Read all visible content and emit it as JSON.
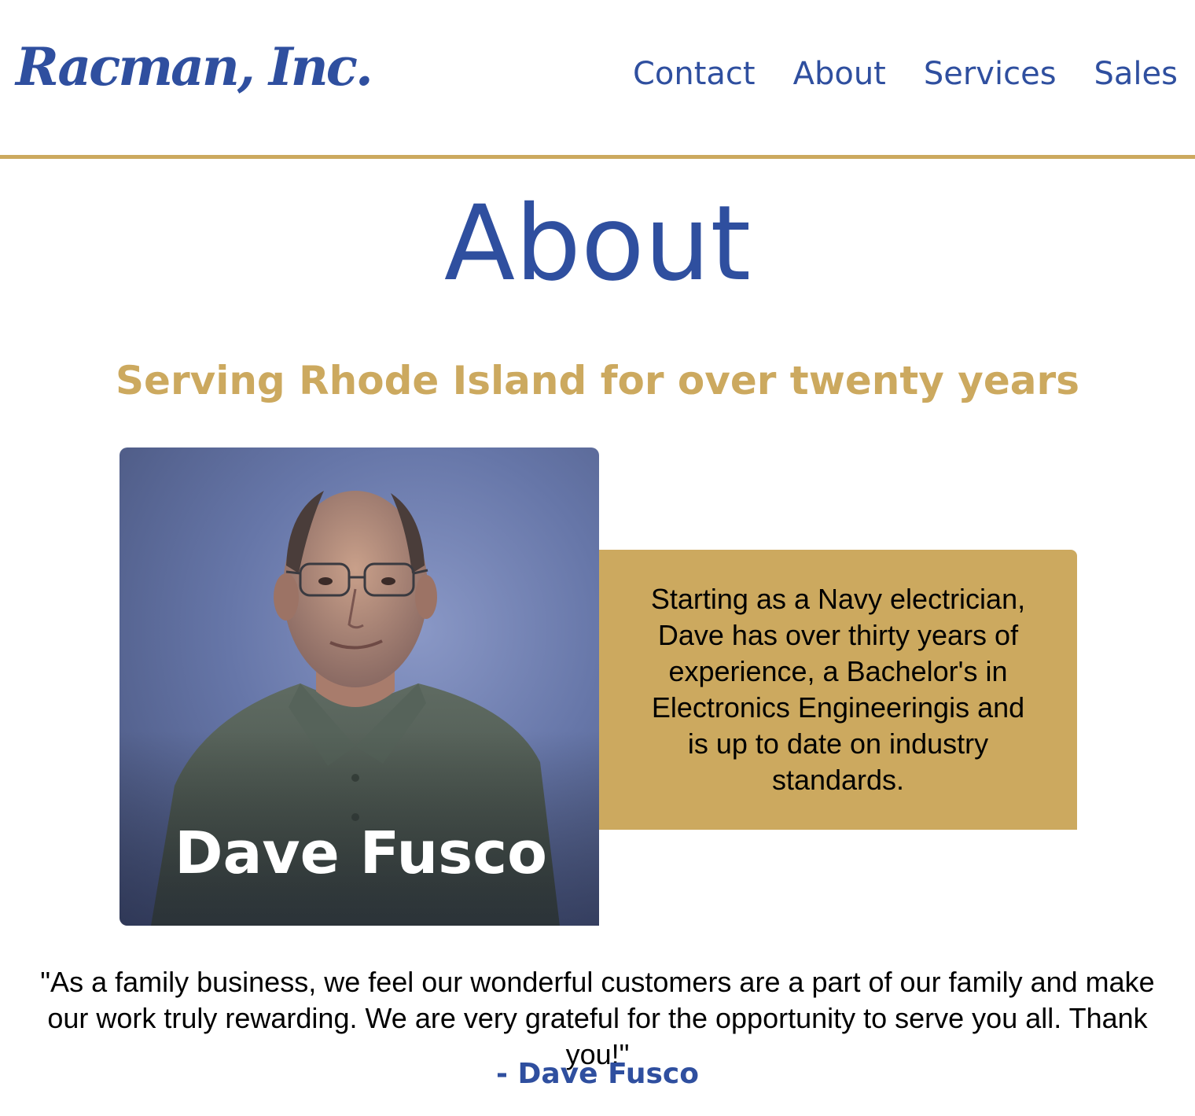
{
  "header": {
    "logo_text": "Racman, Inc.",
    "nav": [
      {
        "label": "Contact"
      },
      {
        "label": "About"
      },
      {
        "label": "Services"
      },
      {
        "label": "Sales"
      }
    ]
  },
  "main": {
    "title": "About",
    "subtitle": "Serving Rhode Island for over twenty years",
    "profile": {
      "name": "Dave Fusco",
      "bio": "Starting as a Navy electrician, Dave has over thirty years of experience, a Bachelor's in Electronics Engineeringis and is up to date on industry standards."
    },
    "quote": {
      "text": "\"As a family business, we feel our wonderful customers are a part of our family and make our work truly rewarding. We are very grateful for the opportunity to serve you all. Thank you!\"",
      "author": "- Dave Fusco"
    }
  },
  "colors": {
    "brand_blue": "#2f4f9f",
    "accent_gold": "#cca95f"
  }
}
